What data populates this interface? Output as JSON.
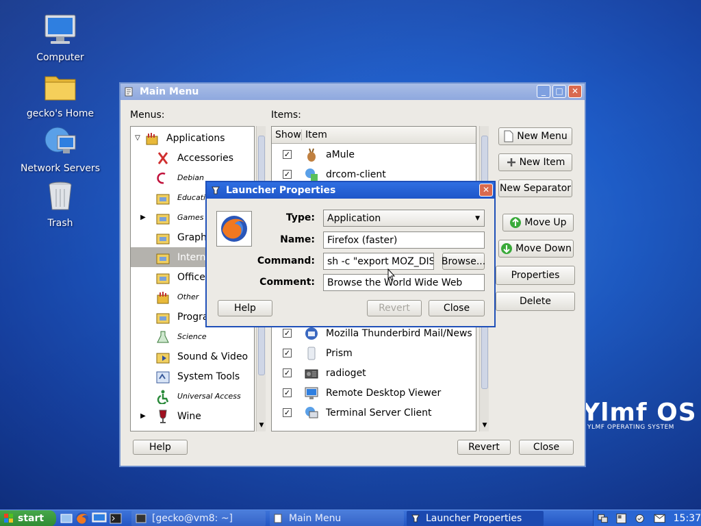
{
  "desktop": {
    "icons": [
      {
        "label": "Computer",
        "icon": "computer-icon"
      },
      {
        "label": "gecko's Home",
        "icon": "folder-home-icon"
      },
      {
        "label": "Network Servers",
        "icon": "network-icon"
      },
      {
        "label": "Trash",
        "icon": "trash-icon"
      }
    ],
    "logo_text": "Ylmf OS",
    "logo_subtext": "YLMF OPERATING SYSTEM"
  },
  "main_menu": {
    "title": "Main Menu",
    "menus_label": "Menus:",
    "items_label": "Items:",
    "menus": [
      {
        "label": "Applications",
        "style": "normal"
      },
      {
        "label": "Accessories",
        "style": "normal"
      },
      {
        "label": "Debian",
        "style": "italic"
      },
      {
        "label": "Educati",
        "style": "italic"
      },
      {
        "label": "Games",
        "style": "italic"
      },
      {
        "label": "Graphi",
        "style": "normal"
      },
      {
        "label": "Intern",
        "style": "selected"
      },
      {
        "label": "Office",
        "style": "normal"
      },
      {
        "label": "Other",
        "style": "italic"
      },
      {
        "label": "Progra",
        "style": "normal"
      },
      {
        "label": "Science",
        "style": "italic"
      },
      {
        "label": "Sound & Video",
        "style": "normal"
      },
      {
        "label": "System Tools",
        "style": "normal"
      },
      {
        "label": "Universal Access",
        "style": "italic"
      },
      {
        "label": "Wine",
        "style": "normal"
      }
    ],
    "items_columns": {
      "show": "Show",
      "item": "Item"
    },
    "items_top": [
      {
        "label": "aMule",
        "checked": true
      },
      {
        "label": "drcom-client",
        "checked": true
      }
    ],
    "items_bottom": [
      {
        "label": "Mozilla Thunderbird Mail/News",
        "checked": true
      },
      {
        "label": "Prism",
        "checked": true
      },
      {
        "label": "radioget",
        "checked": true
      },
      {
        "label": "Remote Desktop Viewer",
        "checked": true
      },
      {
        "label": "Terminal Server Client",
        "checked": true
      }
    ],
    "buttons": {
      "new_menu": "New Menu",
      "new_item": "New Item",
      "new_separator": "New Separator",
      "move_up": "Move Up",
      "move_down": "Move Down",
      "properties": "Properties",
      "delete": "Delete",
      "help": "Help",
      "revert": "Revert",
      "close": "Close"
    }
  },
  "launcher": {
    "title": "Launcher Properties",
    "type_label": "Type:",
    "type_value": "Application",
    "name_label": "Name:",
    "name_value": "Firefox (faster)",
    "command_label": "Command:",
    "command_value": "sh -c \"export MOZ_DISA",
    "browse_label": "Browse...",
    "comment_label": "Comment:",
    "comment_value": "Browse the World Wide Web",
    "help_label": "Help",
    "revert_label": "Revert",
    "close_label": "Close"
  },
  "taskbar": {
    "start_label": "start",
    "tasks": [
      {
        "label": "[gecko@vm8: ~]"
      },
      {
        "label": "Main Menu"
      },
      {
        "label": "Launcher Properties"
      }
    ],
    "clock": "15:37"
  },
  "colors": {
    "titlebar_active": "#1e55c8",
    "titlebar_inactive": "#8ea8de",
    "selection": "#b4b2ad",
    "desktop": "#1f5fcc"
  }
}
